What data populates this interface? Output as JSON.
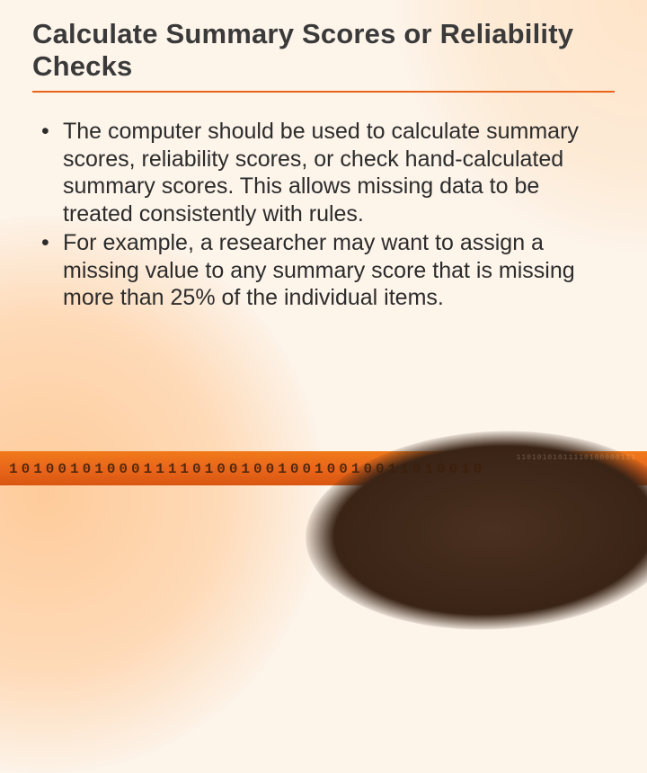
{
  "title": "Calculate Summary Scores or Reliability Checks",
  "bullets": [
    "The computer should be used to calculate summary scores, reliability scores, or check hand-calculated summary scores. This allows missing data to be treated consistently with rules.",
    "For example, a researcher may want to assign a missing value to any summary score that is missing more than 25% of the individual items."
  ],
  "decor": {
    "binary_main": "101001010001111010010010010010011010010",
    "binary_faint": "11010101011110100000111"
  }
}
